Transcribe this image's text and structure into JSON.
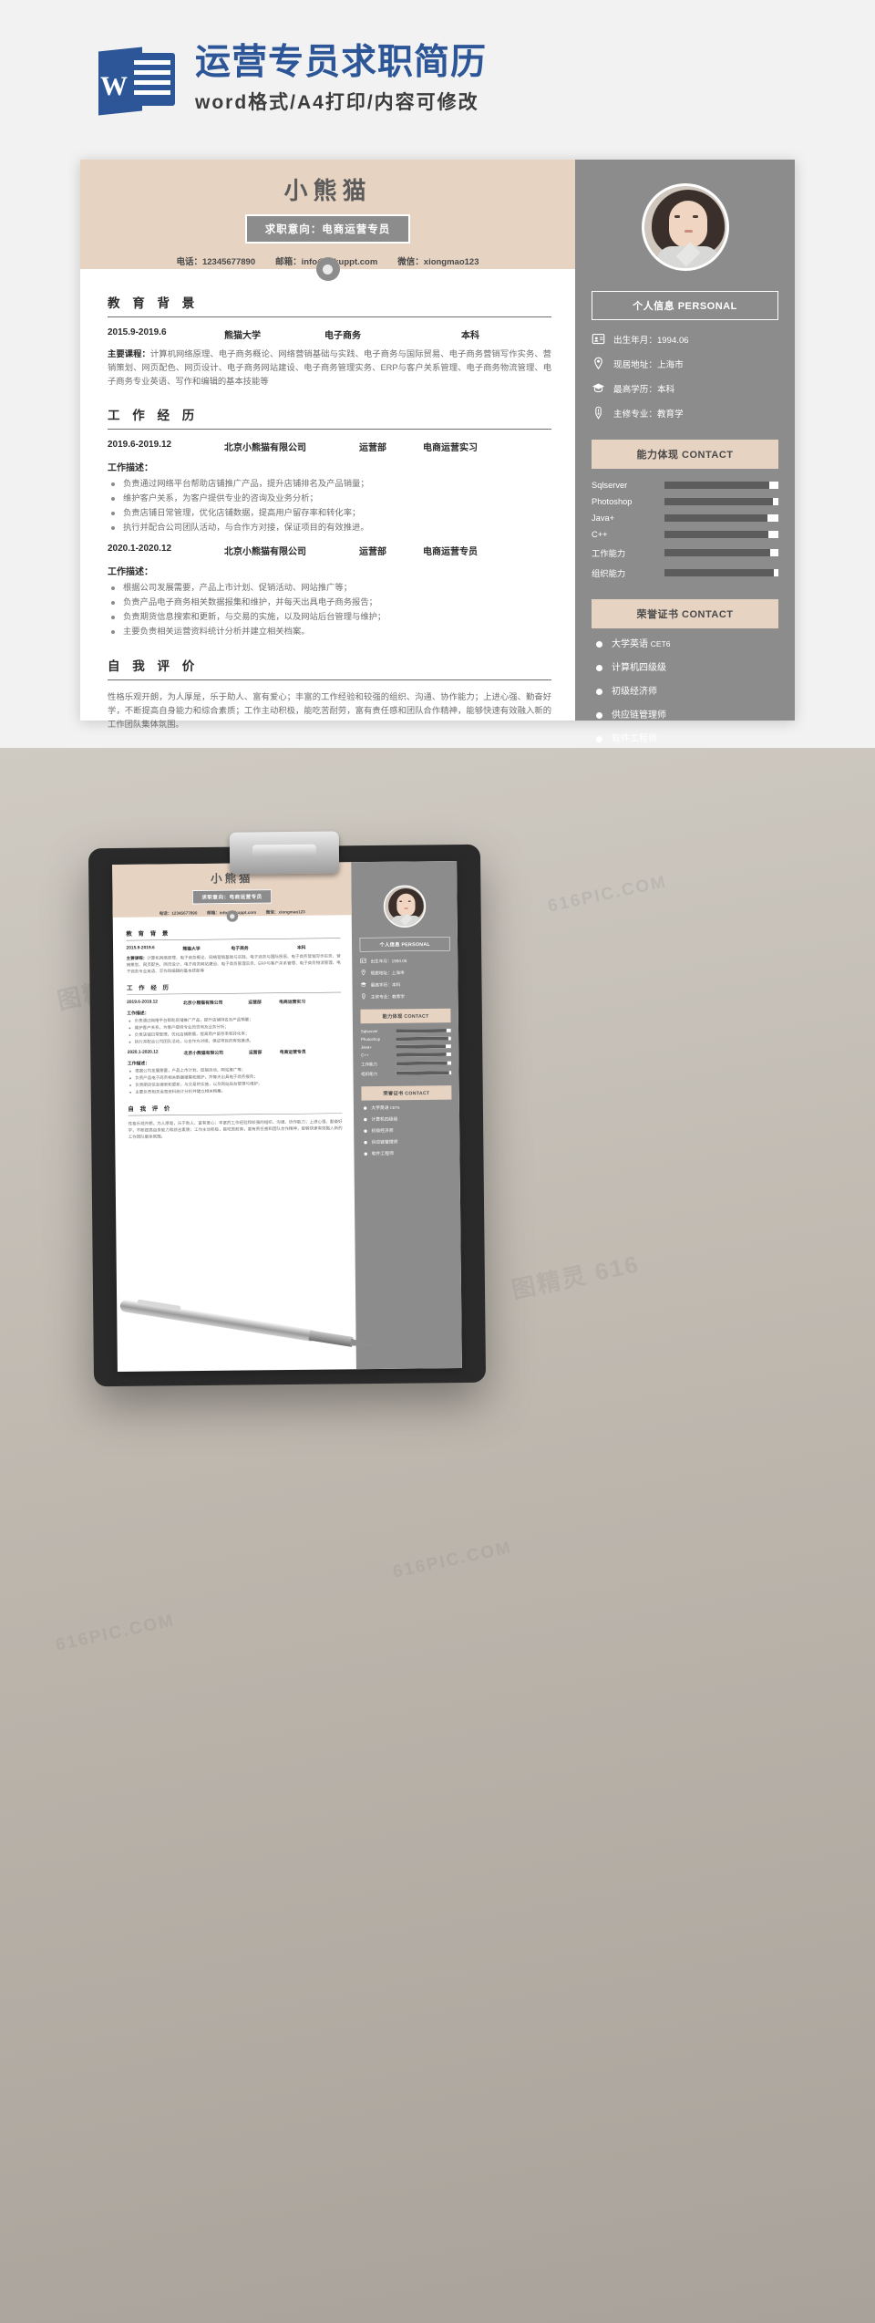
{
  "header": {
    "logo_name": "word-logo",
    "title": "运营专员求职简历",
    "subtitle": "word格式/A4打印/内容可修改",
    "accent_color": "#2c5697"
  },
  "resume": {
    "name": "小熊猫",
    "objective": "求职意向：电商运营专员",
    "contacts": [
      "电话：12345677890",
      "邮箱：info@tukuppt.com",
      "微信：xiongmao123"
    ],
    "sections": {
      "education": {
        "title": "教 育 背 景",
        "row": [
          "2015.9-2019.6",
          "熊猫大学",
          "电子商务",
          "本科"
        ],
        "courses_label": "主要课程：",
        "courses_text": "计算机网络原理、电子商务概论、网络营销基础与实践、电子商务与国际贸易、电子商务营销写作实务、营销策划、网页配色、网页设计、电子商务网站建设、电子商务管理实务、ERP与客户关系管理、电子商务物流管理、电子商务专业英语、写作和编辑的基本技能等"
      },
      "work": {
        "title": "工 作 经 历",
        "jobs": [
          {
            "period": "2019.6-2019.12",
            "company": "北京小熊猫有限公司",
            "dept": "运营部",
            "role": "电商运营实习",
            "desc_label": "工作描述：",
            "bullets": [
              "负责通过网络平台帮助店铺推广产品，提升店铺排名及产品销量；",
              "维护客户关系，为客户提供专业的咨询及业务分析；",
              "负责店铺日常管理，优化店铺数据，提高用户留存率和转化率；",
              "执行并配合公司团队活动，与合作方对接，保证项目的有效推进。"
            ]
          },
          {
            "period": "2020.1-2020.12",
            "company": "北京小熊猫有限公司",
            "dept": "运营部",
            "role": "电商运营专员",
            "desc_label": "工作描述：",
            "bullets": [
              "根据公司发展需要，产品上市计划、促销活动、网站推广等；",
              "负责产品电子商务相关数据报集和维护，并每天出具电子商务报告；",
              "负责期货信息搜索和更新，与交易的实施，以及网站后台管理与维护；",
              "主要负责相关运营资料统计分析并建立相关档案。"
            ]
          }
        ]
      },
      "self": {
        "title": "自 我 评 价",
        "text": "性格乐观开朗，为人厚是，乐于助人、富有爱心；丰富的工作经验和较强的组织、沟通、协作能力；上进心强、勤奋好学，不断提高自身能力和综合素质；工作主动积极，能吃苦耐劳，富有责任感和团队合作精神，能够快速有效融入新的工作团队集体氛围。"
      }
    },
    "sidebar": {
      "avatar_name": "profile-photo",
      "personal_heading": "个人信息  PERSONAL",
      "personal_items": [
        {
          "icon": "id-card-icon",
          "label": "出生年月：1994.06"
        },
        {
          "icon": "location-pin-icon",
          "label": "现居地址：上海市"
        },
        {
          "icon": "graduation-cap-icon",
          "label": "最高学历：本科"
        },
        {
          "icon": "pen-nib-icon",
          "label": "主修专业：教育学"
        }
      ],
      "skills_heading": "能力体现  CONTACT",
      "skills": [
        {
          "name": "Sqlserver",
          "value": 92
        },
        {
          "name": "Photoshop",
          "value": 95
        },
        {
          "name": "Java+",
          "value": 90
        },
        {
          "name": "C++",
          "value": 91
        },
        {
          "name": "工作能力",
          "value": 93
        },
        {
          "name": "组织能力",
          "value": 96
        }
      ],
      "certs_heading": "荣誉证书  CONTACT",
      "certs": [
        {
          "main": "大学英语 ",
          "sub": "CET6"
        },
        {
          "main": "计算机四级级",
          "sub": ""
        },
        {
          "main": "初级经济师",
          "sub": ""
        },
        {
          "main": "供应链管理师",
          "sub": ""
        },
        {
          "main": "软件工程师",
          "sub": ""
        }
      ]
    }
  },
  "scene": {
    "clipboard_name": "clipboard-mockup",
    "pen_name": "pen"
  },
  "watermarks": [
    "图精灵 616PIC.COM",
    "616PIC.COM",
    "图精灵 616PIC.COM",
    "616PIC.COM",
    "图精灵 616PIC.COM"
  ]
}
